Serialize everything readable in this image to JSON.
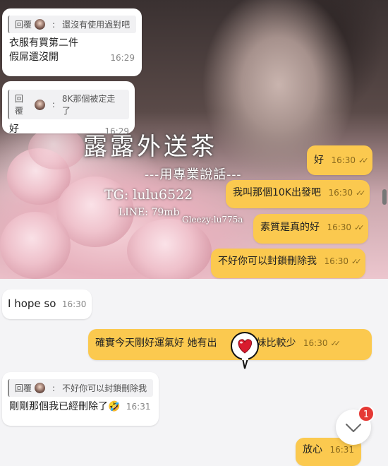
{
  "background": {
    "title": "露露外送茶",
    "subtitle": "---用專業說話---",
    "tg": "TG: lulu6522",
    "line": "LINE: 79mb",
    "gleezy": "Gleezy:lu775a"
  },
  "messages": {
    "m1": {
      "reply_label": "回覆",
      "reply_sep": ":",
      "reply_text": "還沒有使用過對吧",
      "line1": "衣服有買第二件",
      "line2": "假屌還沒開",
      "time": "16:29"
    },
    "m2": {
      "reply_label": "回覆",
      "reply_sep": ":",
      "reply_text": "8K那個被定走了",
      "line1": "好",
      "time": "16:29"
    },
    "o1": {
      "text": "好",
      "time": "16:30",
      "check": "✓✓"
    },
    "o2": {
      "text": "我叫那個10K出發吧",
      "time": "16:30",
      "check": "✓✓"
    },
    "o3": {
      "text": "素質是真的好",
      "time": "16:30",
      "check": "✓✓"
    },
    "o4": {
      "text": "不好你可以封鎖刪除我",
      "time": "16:30",
      "check": "✓✓"
    },
    "m3": {
      "text": "I hope so",
      "time": "16:30"
    },
    "o5": {
      "text": "確實今天剛好運氣好 她有出",
      "text_tail": "學生妹比較少",
      "time": "16:30",
      "check": "✓✓"
    },
    "m4": {
      "reply_label": "回覆",
      "reply_sep": ":",
      "reply_text": "不好你可以封鎖刪除我",
      "line1": "剛剛那個我已經刪除了🤣",
      "time": "16:31"
    },
    "o6": {
      "text": "放心",
      "time": "16:31"
    }
  },
  "scroll_button": {
    "badge_count": "1",
    "icon": "chevron-down-icon"
  },
  "colors": {
    "outgoing": "#fbc94f",
    "incoming": "#ffffff",
    "badge": "#e53935"
  }
}
